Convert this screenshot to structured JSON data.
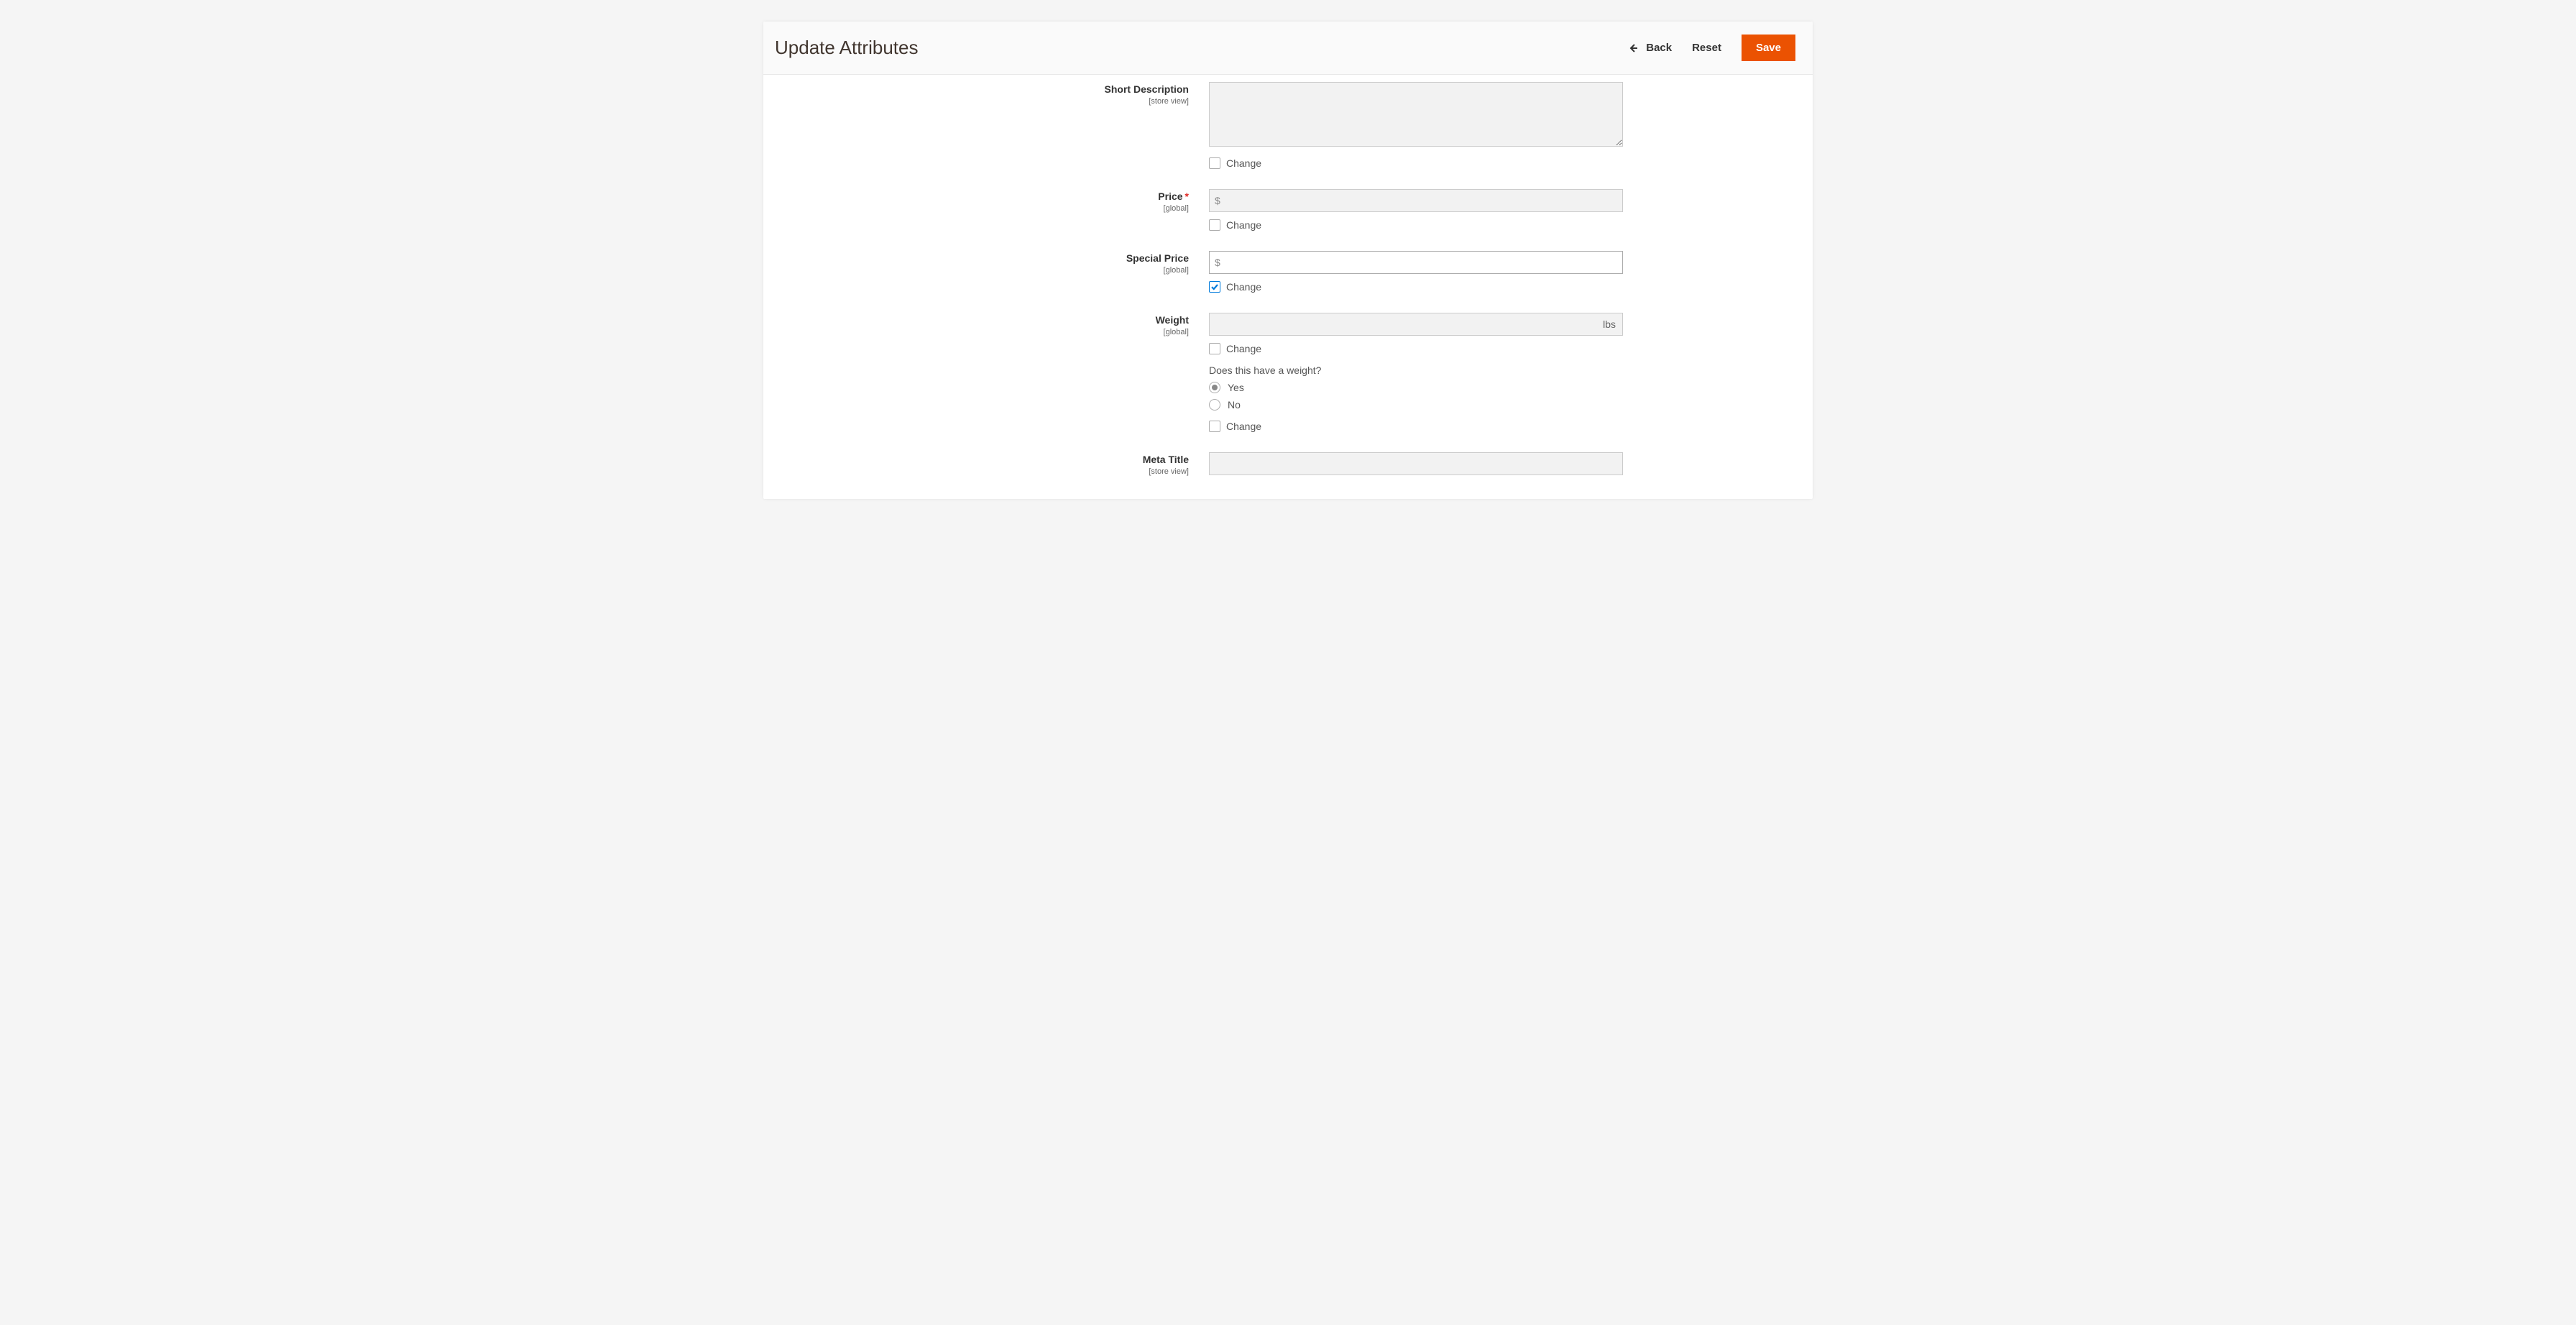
{
  "header": {
    "title": "Update Attributes",
    "back": "Back",
    "reset": "Reset",
    "save": "Save"
  },
  "labels": {
    "change": "Change",
    "yes": "Yes",
    "no": "No",
    "currency": "$",
    "lbs": "lbs"
  },
  "fields": {
    "short_description": {
      "label": "Short Description",
      "scope": "[store view]"
    },
    "price": {
      "label": "Price",
      "scope": "[global]"
    },
    "special_price": {
      "label": "Special Price",
      "scope": "[global]"
    },
    "weight": {
      "label": "Weight",
      "scope": "[global]",
      "question": "Does this have a weight?"
    },
    "meta_title": {
      "label": "Meta Title",
      "scope": "[store view]"
    }
  }
}
